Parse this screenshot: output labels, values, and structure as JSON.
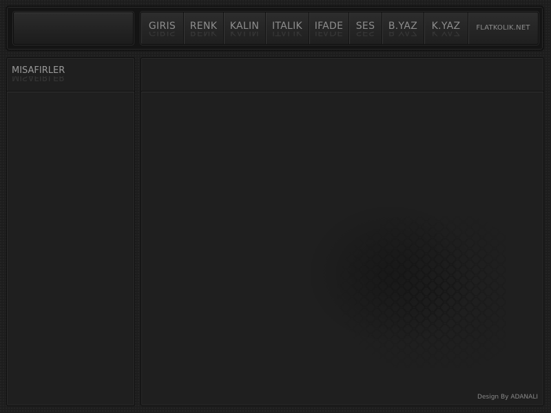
{
  "nav": {
    "items": [
      {
        "label": "GIRIS"
      },
      {
        "label": "RENK"
      },
      {
        "label": "KALIN"
      },
      {
        "label": "ITALIK"
      },
      {
        "label": "IFADE"
      },
      {
        "label": "SES"
      },
      {
        "label": "B.YAZ"
      },
      {
        "label": "K.YAZ"
      },
      {
        "label": "FLATKOLIK.NET"
      }
    ]
  },
  "sidebar": {
    "title": "MISAFIRLER"
  },
  "footer": {
    "credit": "Design By ADANALI"
  }
}
